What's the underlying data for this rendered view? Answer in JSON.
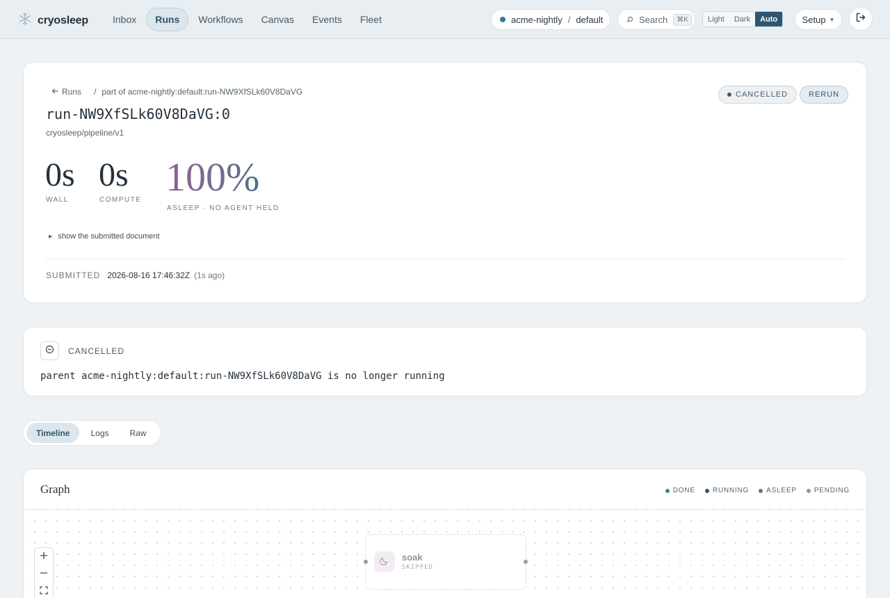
{
  "app": {
    "name": "cryosleep"
  },
  "nav": [
    {
      "label": "Inbox",
      "active": false
    },
    {
      "label": "Runs",
      "active": true
    },
    {
      "label": "Workflows",
      "active": false
    },
    {
      "label": "Canvas",
      "active": false
    },
    {
      "label": "Events",
      "active": false
    },
    {
      "label": "Fleet",
      "active": false
    }
  ],
  "workspace": {
    "org": "acme-nightly",
    "separator": "/",
    "project": "default",
    "status_color": "#2a7ea0"
  },
  "search": {
    "label": "Search",
    "shortcut": "⌘K"
  },
  "theme": {
    "options": [
      "Light",
      "Dark",
      "Auto"
    ],
    "selected": "Auto"
  },
  "setup": {
    "label": "Setup"
  },
  "run": {
    "breadcrumb_back": "Runs",
    "breadcrumb_sep": "/",
    "breadcrumb_parent": "part of acme-nightly:default:run-NW9XfSLk60V8DaVG",
    "title": "run-NW9XfSLk60V8DaVG:0",
    "pipeline": "cryosleep/pipeline/v1",
    "status": "CANCELLED",
    "rerun_label": "RERUN",
    "stats": {
      "wall_value": "0s",
      "wall_label": "WALL",
      "compute_value": "0s",
      "compute_label": "COMPUTE",
      "asleep_value": "100%",
      "asleep_label": "ASLEEP · NO AGENT HELD"
    },
    "document_toggle": "show the submitted document",
    "submitted_label": "SUBMITTED",
    "submitted_time": "2026-08-16 17:46:32Z",
    "submitted_ago": "(1s ago)"
  },
  "cancel_notice": {
    "heading": "CANCELLED",
    "message": "parent acme-nightly:default:run-NW9XfSLk60V8DaVG is no longer running"
  },
  "tabs": [
    {
      "label": "Timeline",
      "active": true
    },
    {
      "label": "Logs",
      "active": false
    },
    {
      "label": "Raw",
      "active": false
    }
  ],
  "graph": {
    "title": "Graph",
    "legend": [
      {
        "label": "DONE",
        "color": "#3f8a6a"
      },
      {
        "label": "RUNNING",
        "color": "#2f5670"
      },
      {
        "label": "ASLEEP",
        "color": "#8d5f8f"
      },
      {
        "label": "PENDING",
        "color": "#8a959e"
      }
    ],
    "node": {
      "name": "soak",
      "state": "SKIPPED"
    }
  }
}
